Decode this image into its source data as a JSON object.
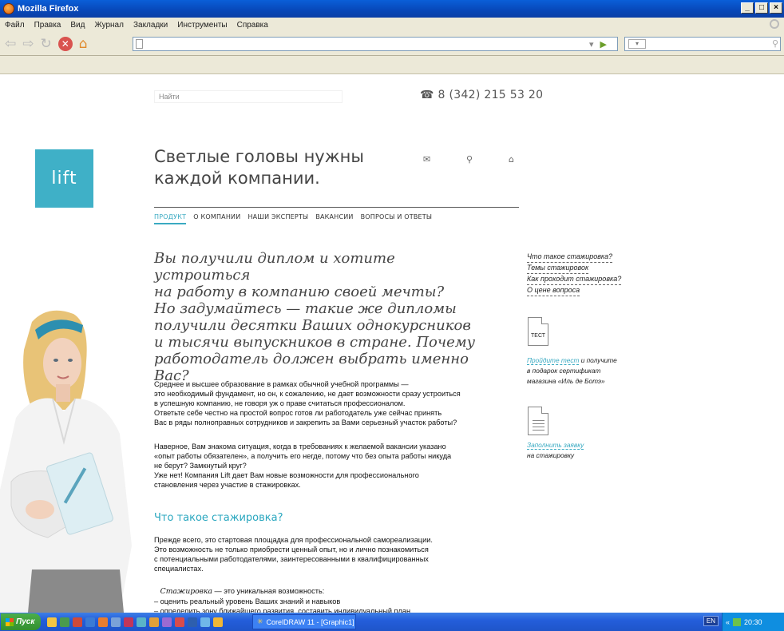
{
  "window": {
    "title": "Mozilla Firefox",
    "buttons": [
      "_",
      "□",
      "×"
    ]
  },
  "menu": [
    "Файл",
    "Правка",
    "Вид",
    "Журнал",
    "Закладки",
    "Инструменты",
    "Справка"
  ],
  "site": {
    "search_placeholder": "Найти",
    "phone": "8 (342) 215 53 20",
    "logo": "lift",
    "headline_line1": "Светлые головы нужны",
    "headline_line2": "каждой компании.",
    "header_icons": [
      "mail-icon",
      "search-icon",
      "home-icon"
    ],
    "tabs": [
      "ПРОДУКТ",
      "О КОМПАНИИ",
      "НАШИ ЭКСПЕРТЫ",
      "ВАКАНСИИ",
      "ВОПРОСЫ И ОТВЕТЫ"
    ],
    "active_tab": "ПРОДУКТ",
    "intro": [
      "Вы получили диплом и хотите устроиться",
      "на работу в компанию своей мечты?",
      "Но задумайтесь — такие же дипломы",
      "получили десятки Ваших однокурсников",
      "и тысячи выпускников в стране. Почему",
      "работодатель должен выбрать именно Вас?"
    ],
    "para1": [
      "Среднее и высшее образование в рамках обычной учебной программы —",
      "это необходимый фундамент, но он, к сожалению, не дает возможности сразу устроиться",
      "в успешную компанию, не говоря уж о праве считаться профессионалом.",
      "Ответьте себе честно на простой вопрос  готов ли работодатель уже сейчас принять",
      "Вас в ряды полноправных сотрудников и закрепить за Вами серьезный участок работы?"
    ],
    "para2": [
      "Наверное, Вам знакома ситуация, когда в требованиях к желаемой вакансии указано",
      "«опыт работы обязателен», а получить его негде, потому что без опыта работы никуда",
      "не берут? Замкнутый круг?",
      "Уже нет! Компания Lift дает Вам новые возможности для профессионального",
      "становления через участие в стажировках."
    ],
    "section_title": "Что такое стажировка?",
    "para3": [
      "Прежде всего, это стартовая площадка для профессиональной самореализации.",
      "Это возможность не только приобрести ценный опыт, но и лично познакомиться",
      "с потенциальными работодателями, заинтересованными в квалифицированных",
      "специалистах."
    ],
    "list_intro_italic": "Стажировка",
    "list_intro_rest": " — это уникальная возможность:",
    "list_items": [
      "– оценить реальный уровень Ваших знаний и навыков",
      "– определить зону ближайшего развития, составить индивидуальный план"
    ],
    "side_links": [
      "Что такое стажировка?",
      "Темы стажировок",
      "Как проходит стажировка?",
      "О цене вопроса"
    ],
    "test_icon_label": "ТЕСТ",
    "test_note_link": "Пройдите тест",
    "test_note_rest": " и получите",
    "test_note_line2": "в подарок сертификат",
    "test_note_line3": "магазина «Иль де Ботэ»",
    "apply_link": "Заполнить заявку",
    "apply_line2": "на стажировку"
  },
  "taskbar": {
    "start": "Пуск",
    "task": "CorelDRAW 11 - [Graphic1]",
    "lang": "EN",
    "time": "20:30"
  },
  "colors": {
    "accent": "#3aaac2",
    "logo_bg": "#3fb0c7",
    "titlebar": "#0a4fc8"
  }
}
